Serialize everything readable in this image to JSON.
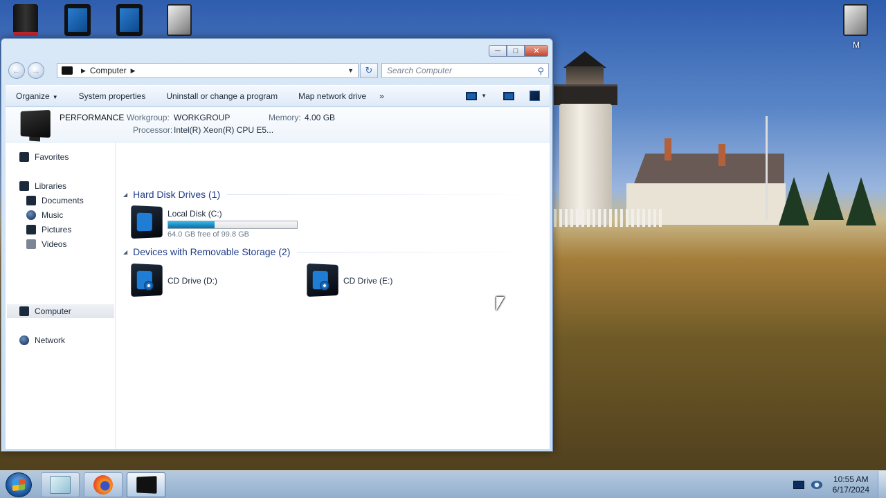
{
  "desktop": {
    "icons": [
      {
        "name": "tower-pc-icon",
        "label": ""
      },
      {
        "name": "tablet-icon-1",
        "label": ""
      },
      {
        "name": "tablet-icon-2",
        "label": ""
      },
      {
        "name": "documents-icon",
        "label": ""
      },
      {
        "name": "m-icon",
        "label": "M"
      }
    ]
  },
  "window": {
    "address": {
      "location": "Computer"
    },
    "search": {
      "placeholder": "Search Computer"
    },
    "toolbar": {
      "organize": "Organize",
      "system_properties": "System properties",
      "uninstall": "Uninstall or change a program",
      "map_drive": "Map network drive",
      "more": "»"
    },
    "details": {
      "pc_name": "PERFORMANCE",
      "workgroup_label": "Workgroup:",
      "workgroup_value": "WORKGROUP",
      "memory_label": "Memory:",
      "memory_value": "4.00 GB",
      "processor_label": "Processor:",
      "processor_value": "Intel(R) Xeon(R) CPU E5..."
    },
    "sidebar": {
      "favorites": "Favorites",
      "libraries": "Libraries",
      "documents": "Documents",
      "music": "Music",
      "pictures": "Pictures",
      "videos": "Videos",
      "computer": "Computer",
      "network": "Network"
    },
    "groups": {
      "hdd_title": "Hard Disk Drives (1)",
      "removable_title": "Devices with Removable Storage (2)"
    },
    "drives": {
      "c_name": "Local Disk (C:)",
      "c_free": "64.0 GB free of 99.8 GB",
      "c_used_fraction": 0.359,
      "d_name": "CD Drive (D:)",
      "e_name": "CD Drive (E:)"
    }
  },
  "taskbar": {
    "time": "10:55 AM",
    "date": "6/17/2024"
  }
}
